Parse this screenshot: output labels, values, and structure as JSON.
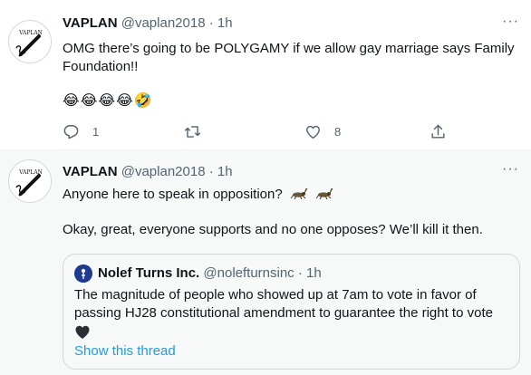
{
  "tweets": [
    {
      "name": "VAPLAN",
      "handle": "@vaplan2018",
      "dot": "·",
      "time": "1h",
      "more": "···",
      "avatar_text": "VAPLAN",
      "text": "OMG there’s going to be POLYGAMY if we allow gay marriage says Family Foundation!!",
      "emojis": "😂😂😂😂🤣",
      "actions": {
        "reply_count": "1",
        "retweet_count": "",
        "like_count": "8"
      }
    },
    {
      "name": "VAPLAN",
      "handle": "@vaplan2018",
      "dot": "·",
      "time": "1h",
      "more": "···",
      "avatar_text": "VAPLAN",
      "line1": "Anyone here to speak in opposition?",
      "line2": "Okay, great, everyone supports and no one opposes? We’ll kill it then.",
      "quote": {
        "name": "Nolef Turns Inc.",
        "handle": "@nolefturnsinc",
        "dot": "·",
        "time": "1h",
        "text": "The magnitude of people who showed up at 7am to vote in favor of passing HJ28 constitutional amendment to guarantee the right to vote",
        "show_thread": "Show this thread"
      }
    }
  ],
  "icons": [
    "reply-icon",
    "retweet-icon",
    "like-icon",
    "share-icon",
    "more-icon",
    "cricket-icon",
    "black-heart-icon"
  ],
  "colors": {
    "link": "#1d9bf0",
    "secondary": "#536471",
    "text": "#0f1419",
    "border": "#cfd9de",
    "tweet2_bg": "#f7f9f9"
  }
}
